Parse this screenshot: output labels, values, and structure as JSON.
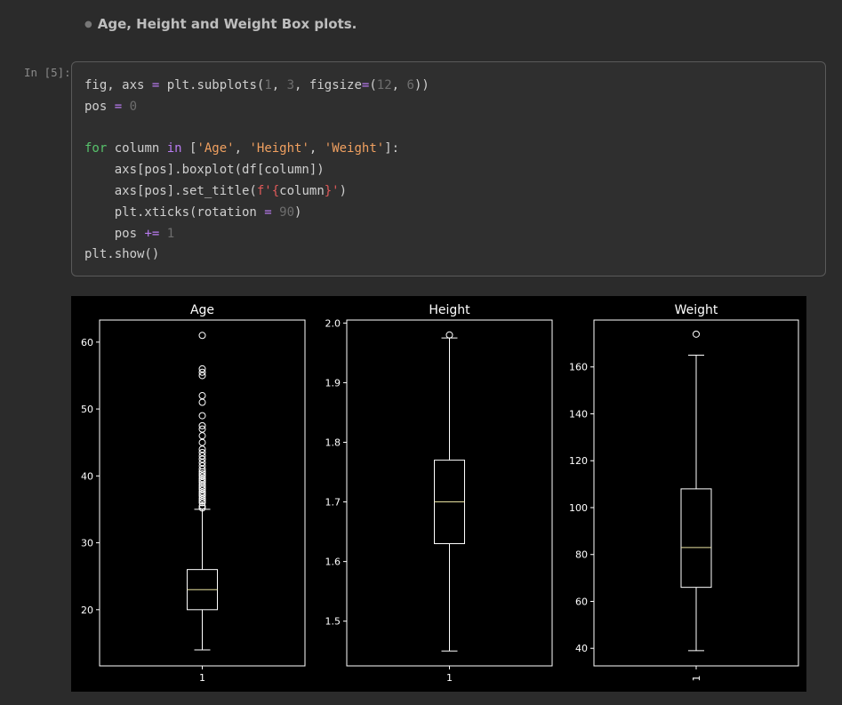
{
  "markdown": {
    "heading": "Age, Height and Weight Box plots."
  },
  "cell": {
    "prompt": "In [5]:",
    "code_lines": [
      [
        [
          "t",
          "fig, axs "
        ],
        [
          "op",
          "="
        ],
        [
          "t",
          " plt.subplots("
        ],
        [
          "num",
          "1"
        ],
        [
          "t",
          ", "
        ],
        [
          "num",
          "3"
        ],
        [
          "t",
          ", figsize"
        ],
        [
          "op",
          "="
        ],
        [
          "t",
          "("
        ],
        [
          "num",
          "12"
        ],
        [
          "t",
          ", "
        ],
        [
          "num",
          "6"
        ],
        [
          "t",
          "))"
        ]
      ],
      [
        [
          "t",
          "pos "
        ],
        [
          "op",
          "="
        ],
        [
          "t",
          " "
        ],
        [
          "num",
          "0"
        ]
      ],
      [
        [
          "t",
          ""
        ]
      ],
      [
        [
          "kw",
          "for"
        ],
        [
          "t",
          " column "
        ],
        [
          "op",
          "in"
        ],
        [
          "t",
          " ["
        ],
        [
          "str",
          "'Age'"
        ],
        [
          "t",
          ", "
        ],
        [
          "str",
          "'Height'"
        ],
        [
          "t",
          ", "
        ],
        [
          "str",
          "'Weight'"
        ],
        [
          "t",
          "]:"
        ]
      ],
      [
        [
          "t",
          "    axs[pos].boxplot(df[column])"
        ]
      ],
      [
        [
          "t",
          "    axs[pos].set_title("
        ],
        [
          "fs",
          "f'{"
        ],
        [
          "t",
          "column"
        ],
        [
          "fs",
          "}'"
        ],
        [
          "t",
          ")"
        ]
      ],
      [
        [
          "t",
          "    plt.xticks(rotation "
        ],
        [
          "op",
          "="
        ],
        [
          "t",
          " "
        ],
        [
          "num",
          "90"
        ],
        [
          "t",
          ")"
        ]
      ],
      [
        [
          "t",
          "    pos "
        ],
        [
          "op",
          "+="
        ],
        [
          "t",
          " "
        ],
        [
          "num",
          "1"
        ]
      ],
      [
        [
          "t",
          "plt.show()"
        ]
      ]
    ]
  },
  "colors": {
    "background": "#2b2b2b",
    "median": "#e8e2a0",
    "box": "#ffffff"
  },
  "chart_data": [
    {
      "type": "box",
      "title": "Age",
      "categories": [
        "1"
      ],
      "xtick_rotation": 0,
      "ylim": [
        11.6,
        63.3
      ],
      "yticks": [
        20,
        30,
        40,
        50,
        60
      ],
      "box": {
        "whisker_low": 14,
        "q1": 20,
        "median": 23,
        "q3": 26,
        "whisker_high": 35
      },
      "outliers": [
        35.2,
        35.5,
        36,
        36.3,
        36.6,
        37,
        37.3,
        37.6,
        38,
        38.3,
        38.6,
        39,
        39.3,
        39.6,
        40,
        40.3,
        40.6,
        41,
        41.5,
        42,
        42.5,
        43,
        43.5,
        44,
        45,
        46,
        47,
        47.5,
        49,
        51,
        52,
        55,
        55.5,
        56,
        61
      ]
    },
    {
      "type": "box",
      "title": "Height",
      "categories": [
        "1"
      ],
      "xtick_rotation": 0,
      "ylim": [
        1.425,
        2.005
      ],
      "yticks": [
        1.5,
        1.6,
        1.7,
        1.8,
        1.9,
        2.0
      ],
      "box": {
        "whisker_low": 1.45,
        "q1": 1.63,
        "median": 1.7,
        "q3": 1.77,
        "whisker_high": 1.975
      },
      "outliers": [
        1.98
      ]
    },
    {
      "type": "box",
      "title": "Weight",
      "categories": [
        "1"
      ],
      "xtick_rotation": 90,
      "ylim": [
        32.5,
        180
      ],
      "yticks": [
        40,
        60,
        80,
        100,
        120,
        140,
        160
      ],
      "box": {
        "whisker_low": 39,
        "q1": 66,
        "median": 83,
        "q3": 108,
        "whisker_high": 165
      },
      "outliers": [
        174
      ]
    }
  ]
}
